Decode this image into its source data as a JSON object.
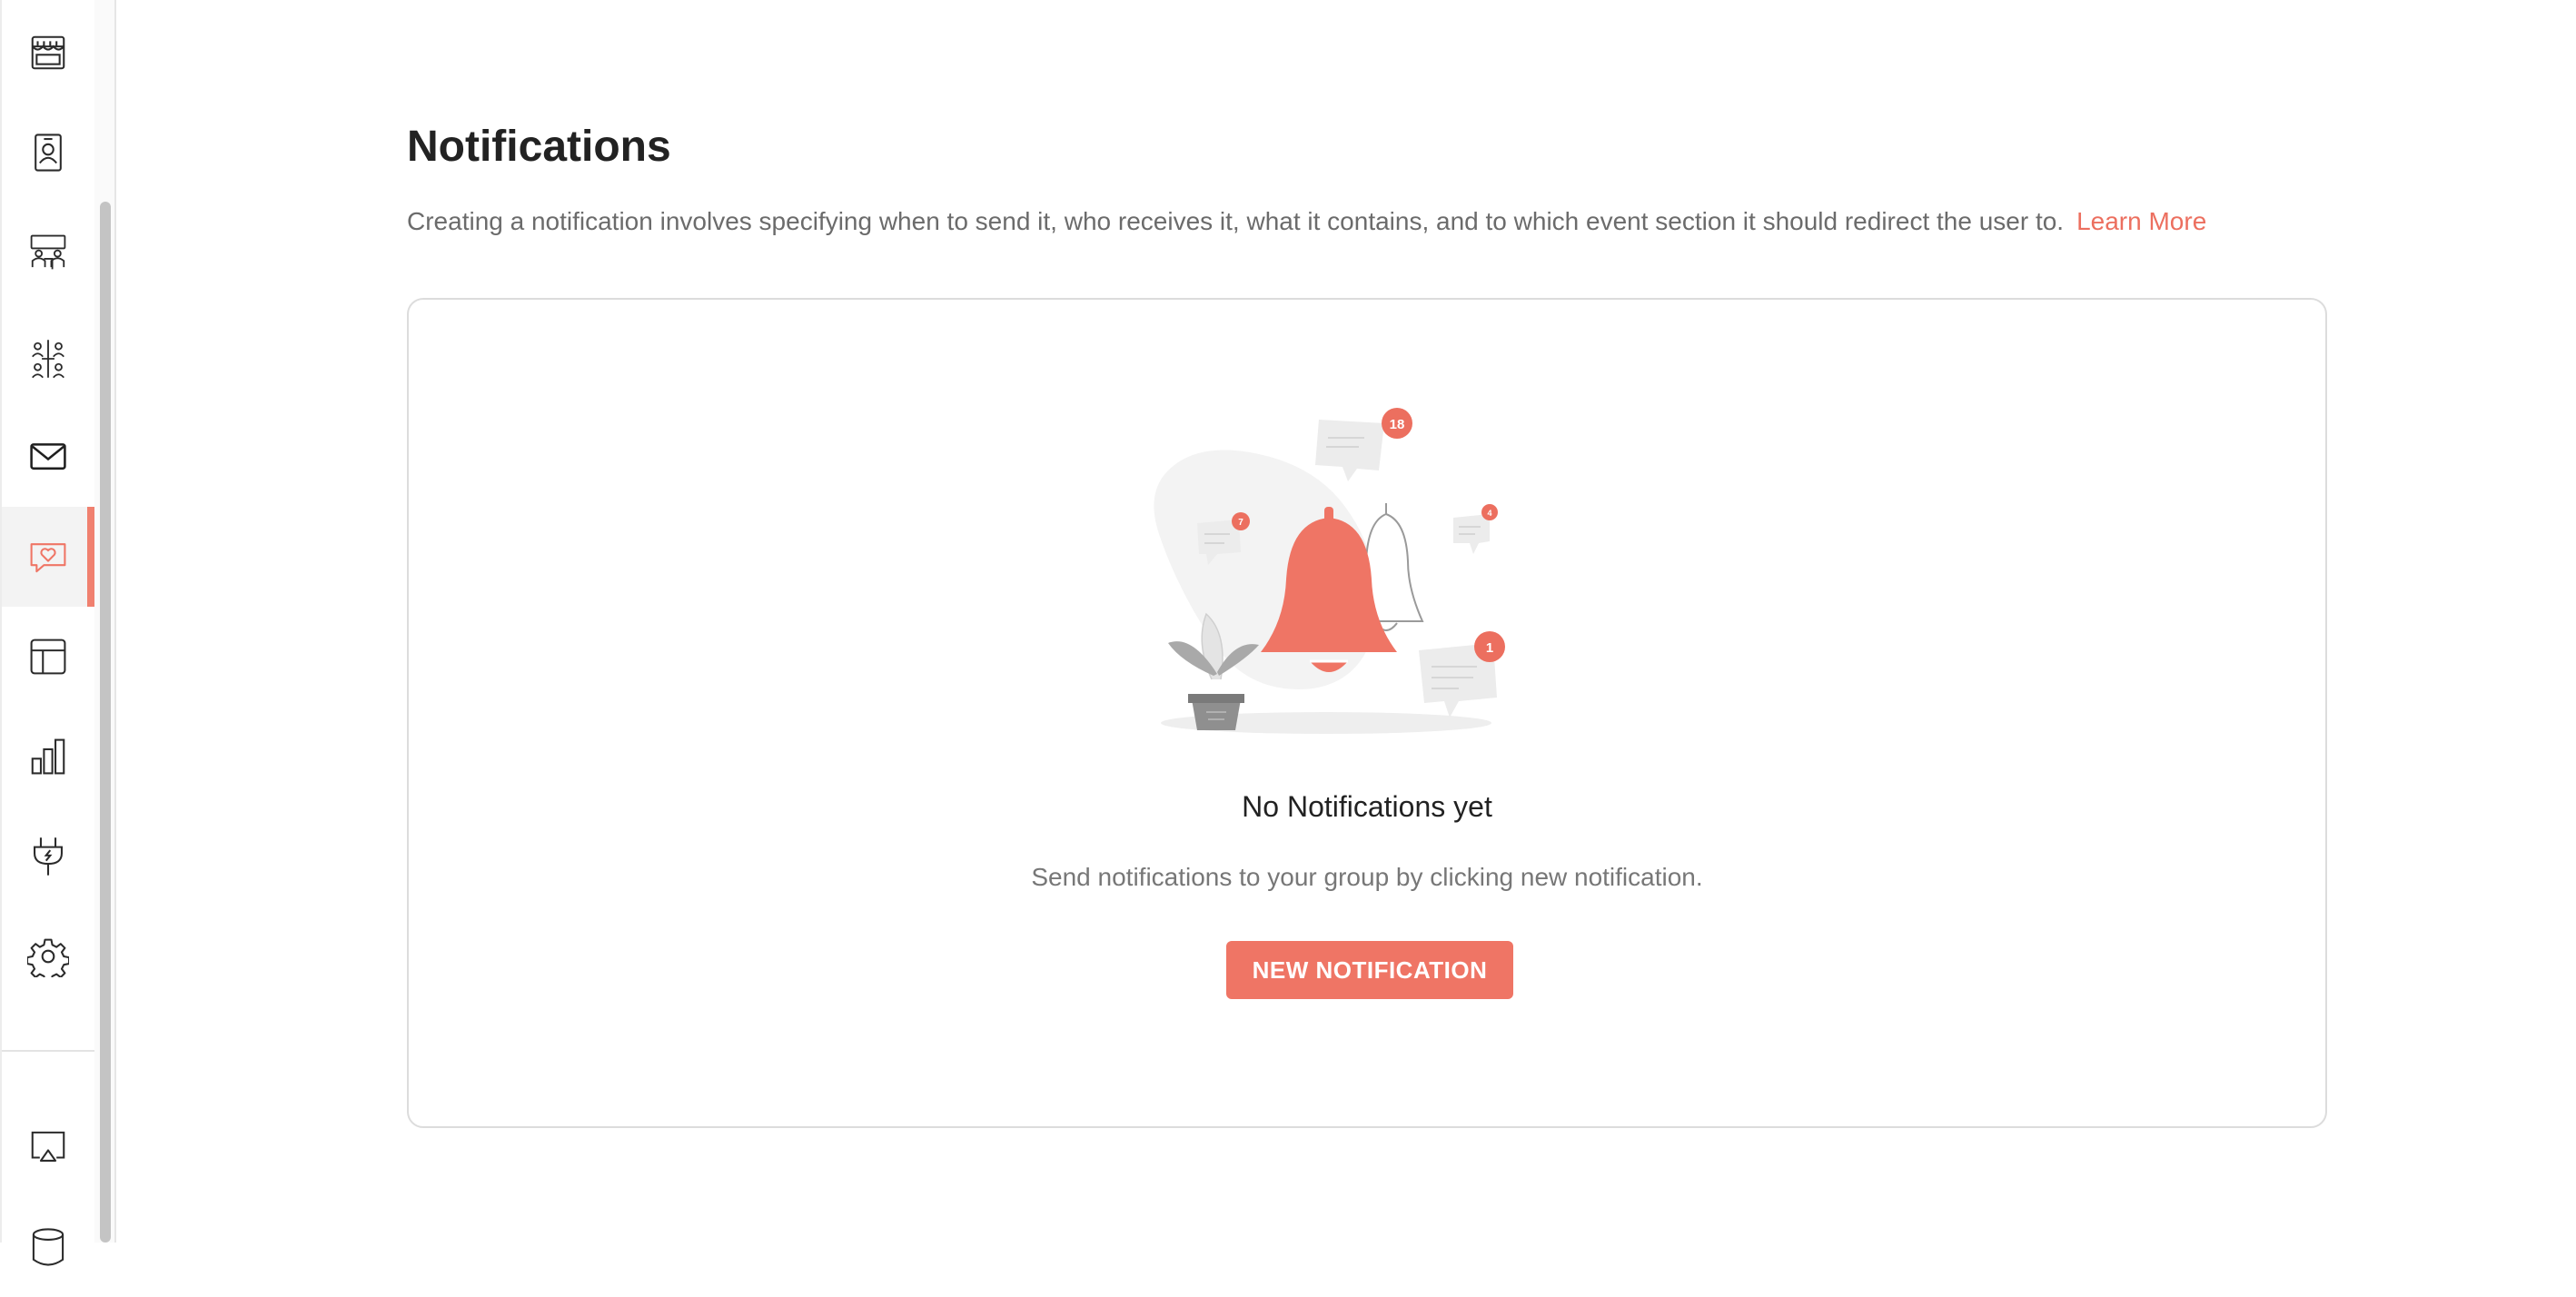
{
  "sidebar": {
    "items": [
      {
        "icon": "storefront-icon",
        "active": false
      },
      {
        "icon": "badge-icon",
        "active": false
      },
      {
        "icon": "meeting-icon",
        "active": false
      },
      {
        "icon": "people-network-icon",
        "active": false
      },
      {
        "icon": "mail-icon",
        "active": false
      },
      {
        "icon": "heart-chat-icon",
        "active": true
      },
      {
        "icon": "layout-icon",
        "active": false
      },
      {
        "icon": "bar-chart-icon",
        "active": false
      },
      {
        "icon": "plug-icon",
        "active": false
      },
      {
        "icon": "gear-icon",
        "active": false
      }
    ],
    "bottom_items": [
      {
        "icon": "cast-icon"
      },
      {
        "icon": "database-icon"
      }
    ]
  },
  "page": {
    "title": "Notifications",
    "description": "Creating a notification involves specifying when to send it, who receives it, what it contains, and to which event section it should redirect the user to.",
    "learn_more": "Learn More"
  },
  "empty_state": {
    "title": "No Notifications yet",
    "subtitle": "Send notifications to your group by clicking new notification.",
    "button_label": "NEW NOTIFICATION",
    "badges": [
      "18",
      "7",
      "4",
      "1"
    ]
  },
  "colors": {
    "accent": "#ef7565",
    "text": "#222222",
    "muted": "#6b6b6b"
  }
}
